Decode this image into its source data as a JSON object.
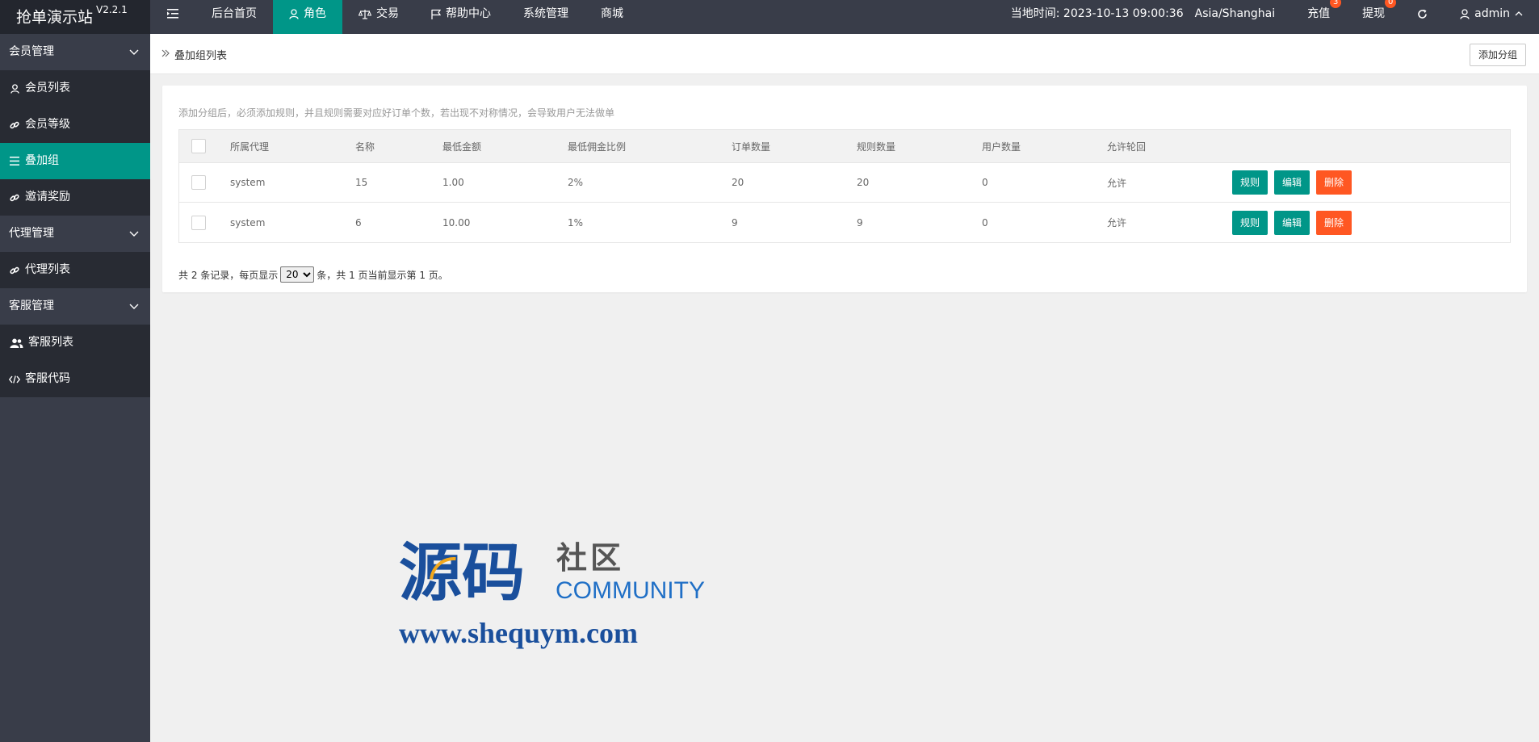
{
  "app": {
    "title": "抢单演示站",
    "version": "V2.2.1"
  },
  "topnav": {
    "items": [
      {
        "label": "后台首页",
        "icon": "none"
      },
      {
        "label": "角色",
        "icon": "user-icon"
      },
      {
        "label": "交易",
        "icon": "scale-icon"
      },
      {
        "label": "帮助中心",
        "icon": "flag-icon"
      },
      {
        "label": "系统管理",
        "icon": "none"
      },
      {
        "label": "商城",
        "icon": "none"
      }
    ],
    "active_index": 1
  },
  "topright": {
    "time_label": "当地时间: 2023-10-13 09:00:36",
    "timezone": "Asia/Shanghai",
    "recharge_label": "充值",
    "recharge_badge": "3",
    "withdraw_label": "提现",
    "withdraw_badge": "0",
    "user_label": "admin"
  },
  "sidebar": {
    "groups": [
      {
        "label": "会员管理",
        "items": [
          {
            "label": "会员列表",
            "icon": "user-icon"
          },
          {
            "label": "会员等级",
            "icon": "link-icon"
          },
          {
            "label": "叠加组",
            "icon": "list-icon",
            "active": true
          },
          {
            "label": "邀请奖励",
            "icon": "link-icon"
          }
        ]
      },
      {
        "label": "代理管理",
        "items": [
          {
            "label": "代理列表",
            "icon": "link-icon"
          }
        ]
      },
      {
        "label": "客服管理",
        "items": [
          {
            "label": "客服列表",
            "icon": "users-icon"
          },
          {
            "label": "客服代码",
            "icon": "code-icon"
          }
        ]
      }
    ]
  },
  "breadcrumb": {
    "title": "叠加组列表"
  },
  "toolbar": {
    "add_group_label": "添加分组"
  },
  "tip": "添加分组后，必须添加规则，并且规则需要对应好订单个数，若出现不对称情况，会导致用户无法做单",
  "table": {
    "headers": [
      "所属代理",
      "名称",
      "最低金额",
      "最低佣金比例",
      "订单数量",
      "规则数量",
      "用户数量",
      "允许轮回"
    ],
    "rows": [
      {
        "agent": "system",
        "name": "15",
        "min_amount": "1.00",
        "min_commission": "2%",
        "orders": "20",
        "rules": "20",
        "users": "0",
        "loop": "允许"
      },
      {
        "agent": "system",
        "name": "6",
        "min_amount": "10.00",
        "min_commission": "1%",
        "orders": "9",
        "rules": "9",
        "users": "0",
        "loop": "允许"
      }
    ],
    "actions": {
      "rule": "规则",
      "edit": "编辑",
      "delete": "删除"
    }
  },
  "pager": {
    "prefix": "共 2 条记录，每页显示",
    "page_size": "20",
    "suffix": "条，共 1 页当前显示第 1 页。"
  },
  "watermark": {
    "big": "源码",
    "small": "社区",
    "community": "COMMUNITY",
    "url": "www.shequym.com"
  },
  "colors": {
    "header": "#393d49",
    "accent": "#009688",
    "danger": "#ff5722"
  }
}
